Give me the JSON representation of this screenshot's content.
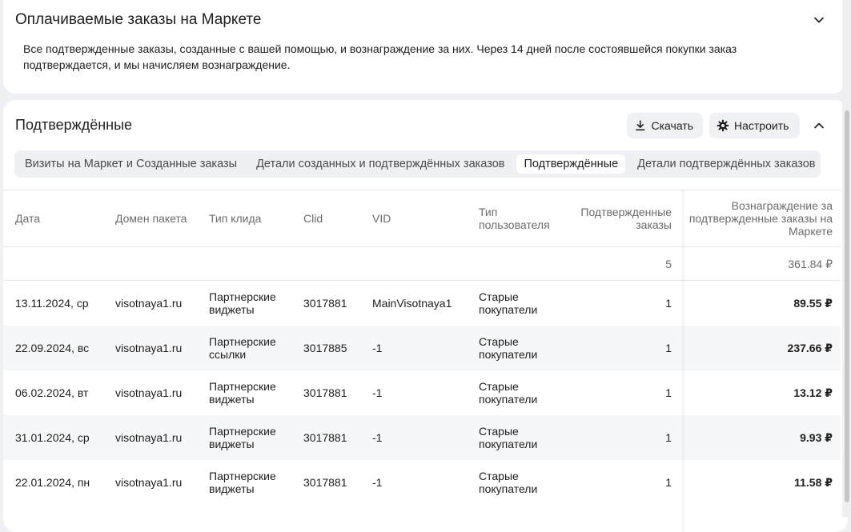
{
  "paid_orders": {
    "title": "Оплачиваемые заказы на Маркете",
    "description": "Все подтвержденные заказы, созданные с вашей помощью, и вознаграждение за них. Через 14 дней после состоявшейся покупки заказ подтверждается, и мы начисляем вознаграждение."
  },
  "confirmed": {
    "title": "Подтверждённые",
    "download_label": "Скачать",
    "settings_label": "Настроить",
    "tabs": [
      {
        "label": "Визиты на Маркет и Созданные заказы"
      },
      {
        "label": "Детали созданных и подтверждённых заказов"
      },
      {
        "label": "Подтверждённые"
      },
      {
        "label": "Детали подтверждённых заказов"
      }
    ],
    "active_tab": 2
  },
  "table": {
    "headers": {
      "date": "Дата",
      "domain": "Домен пакета",
      "click_type": "Тип клида",
      "clid": "Clid",
      "vid": "VID",
      "user_type": "Тип пользователя",
      "orders": "Подтвержденные заказы",
      "reward": "Вознаграждение за подтвержденные заказы на Маркете"
    },
    "totals": {
      "orders": "5",
      "reward": "361.84 ₽"
    },
    "rows": [
      {
        "date": "13.11.2024, ср",
        "domain": "visotnaya1.ru",
        "click_type": "Партнерские виджеты",
        "clid": "3017881",
        "vid": "MainVisotnaya1",
        "user_type": "Старые покупатели",
        "orders": "1",
        "reward": "89.55 ₽"
      },
      {
        "date": "22.09.2024, вс",
        "domain": "visotnaya1.ru",
        "click_type": "Партнерские ссылки",
        "clid": "3017885",
        "vid": "-1",
        "user_type": "Старые покупатели",
        "orders": "1",
        "reward": "237.66 ₽"
      },
      {
        "date": "06.02.2024, вт",
        "domain": "visotnaya1.ru",
        "click_type": "Партнерские виджеты",
        "clid": "3017881",
        "vid": "-1",
        "user_type": "Старые покупатели",
        "orders": "1",
        "reward": "13.12 ₽"
      },
      {
        "date": "31.01.2024, ср",
        "domain": "visotnaya1.ru",
        "click_type": "Партнерские виджеты",
        "clid": "3017881",
        "vid": "-1",
        "user_type": "Старые покупатели",
        "orders": "1",
        "reward": "9.93 ₽"
      },
      {
        "date": "22.01.2024, пн",
        "domain": "visotnaya1.ru",
        "click_type": "Партнерские виджеты",
        "clid": "3017881",
        "vid": "-1",
        "user_type": "Старые покупатели",
        "orders": "1",
        "reward": "11.58 ₽"
      }
    ]
  },
  "icons": {
    "collapse": "chevron-down-icon",
    "expand": "chevron-up-icon",
    "download": "download-icon",
    "settings": "gear-icon"
  }
}
